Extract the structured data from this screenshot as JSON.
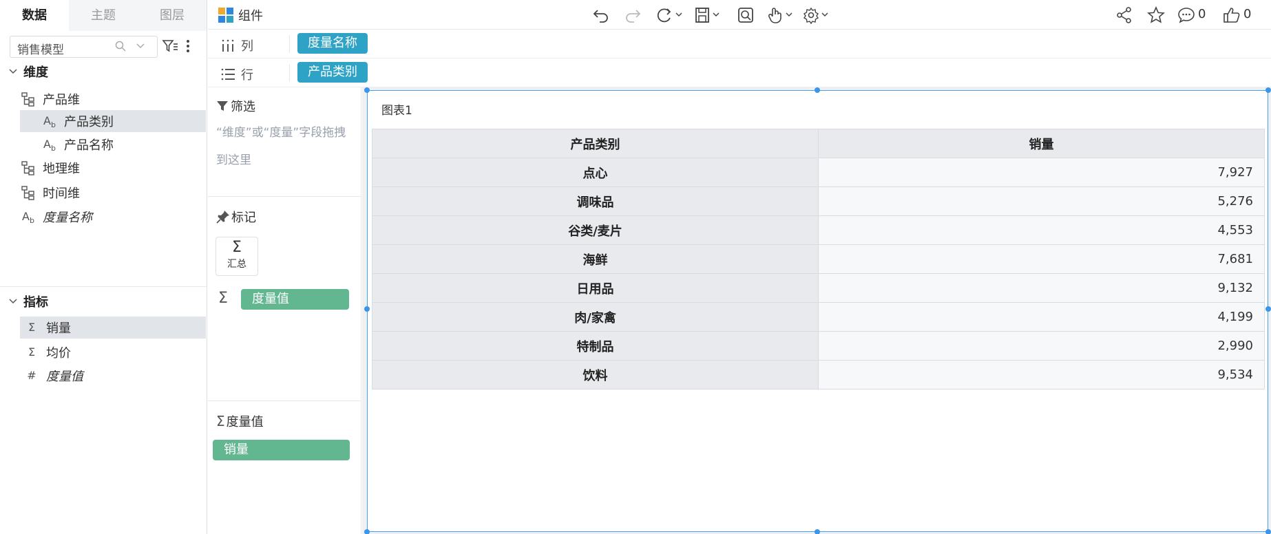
{
  "left_panel": {
    "tabs": [
      {
        "label": "数据"
      },
      {
        "label": "主题"
      },
      {
        "label": "图层"
      }
    ],
    "model_select": {
      "value": "销售模型"
    },
    "dimensions": {
      "title": "维度",
      "items": [
        {
          "label": "产品维"
        },
        {
          "label": "产品类别"
        },
        {
          "label": "产品名称"
        },
        {
          "label": "地理维"
        },
        {
          "label": "时间维"
        },
        {
          "label": "度量名称"
        }
      ]
    },
    "measures": {
      "title": "指标",
      "items": [
        {
          "label": "销量"
        },
        {
          "label": "均价"
        },
        {
          "label": "度量值"
        }
      ]
    }
  },
  "toolbar": {
    "title": "组件",
    "comments_count": "0",
    "likes_count": "0"
  },
  "shelves": {
    "columns": {
      "label": "列",
      "pill": "度量名称"
    },
    "rows": {
      "label": "行",
      "pill": "产品类别"
    }
  },
  "marks_panel": {
    "filter_title": "筛选",
    "filter_hint": "“维度”或“度量”字段拖拽到这里",
    "marks_title": "标记",
    "summary_label": "汇总",
    "measure_value_pill": "度量值",
    "measure_values_title": "度量值",
    "measure_pill": "销量"
  },
  "colors": {
    "accent_blue": "#2ea3c6",
    "accent_green": "#62b791",
    "selection": "#3d95e8"
  },
  "chart": {
    "title": "图表1",
    "headers": [
      "产品类别",
      "销量"
    ],
    "rows": [
      {
        "category": "点心",
        "value": "7,927"
      },
      {
        "category": "调味品",
        "value": "5,276"
      },
      {
        "category": "谷类/麦片",
        "value": "4,553"
      },
      {
        "category": "海鲜",
        "value": "7,681"
      },
      {
        "category": "日用品",
        "value": "9,132"
      },
      {
        "category": "肉/家禽",
        "value": "4,199"
      },
      {
        "category": "特制品",
        "value": "2,990"
      },
      {
        "category": "饮料",
        "value": "9,534"
      }
    ]
  }
}
